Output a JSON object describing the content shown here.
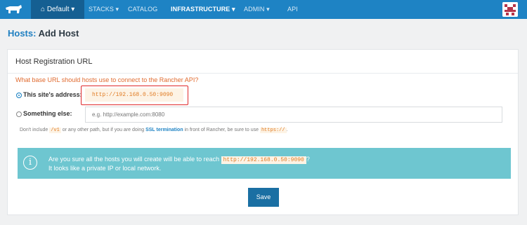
{
  "nav": {
    "environment": "⌂ Default ▾",
    "items": [
      {
        "label": "STACKS ▾"
      },
      {
        "label": "CATALOG"
      },
      {
        "label": "INFRASTRUCTURE ▾"
      },
      {
        "label": "ADMIN ▾"
      },
      {
        "label": "API"
      }
    ],
    "active_item": "INFRASTRUCTURE",
    "colors": {
      "bar": "#1e83c4",
      "env": "#155f92"
    }
  },
  "page": {
    "title_prefix": "Hosts:",
    "title_rest": " Add Host"
  },
  "card": {
    "title": "Host Registration URL",
    "question": "What base URL should hosts use to connect to the Rancher API?",
    "option_site": {
      "label": "This site's address:",
      "value": "http://192.168.0.50:9090",
      "selected": true
    },
    "option_else": {
      "label": "Something else:",
      "placeholder": "e.g. http://example.com:8080",
      "selected": false
    },
    "help": {
      "part1": "Don't include ",
      "code1": "/v1",
      "part2": " or any other path, but if you are doing ",
      "strong": "SSL termination",
      "part3": " in front of Rancher, be sure to use ",
      "code2": "https://",
      "part4": "."
    },
    "banner": {
      "line1_prefix": "Are you sure all the hosts you will create will be able to reach ",
      "line1_code": "http://192.168.0.50:9090",
      "line1_suffix": "?",
      "line2": "It looks like a private IP or local network.",
      "icon": "i"
    },
    "save_label": "Save"
  }
}
